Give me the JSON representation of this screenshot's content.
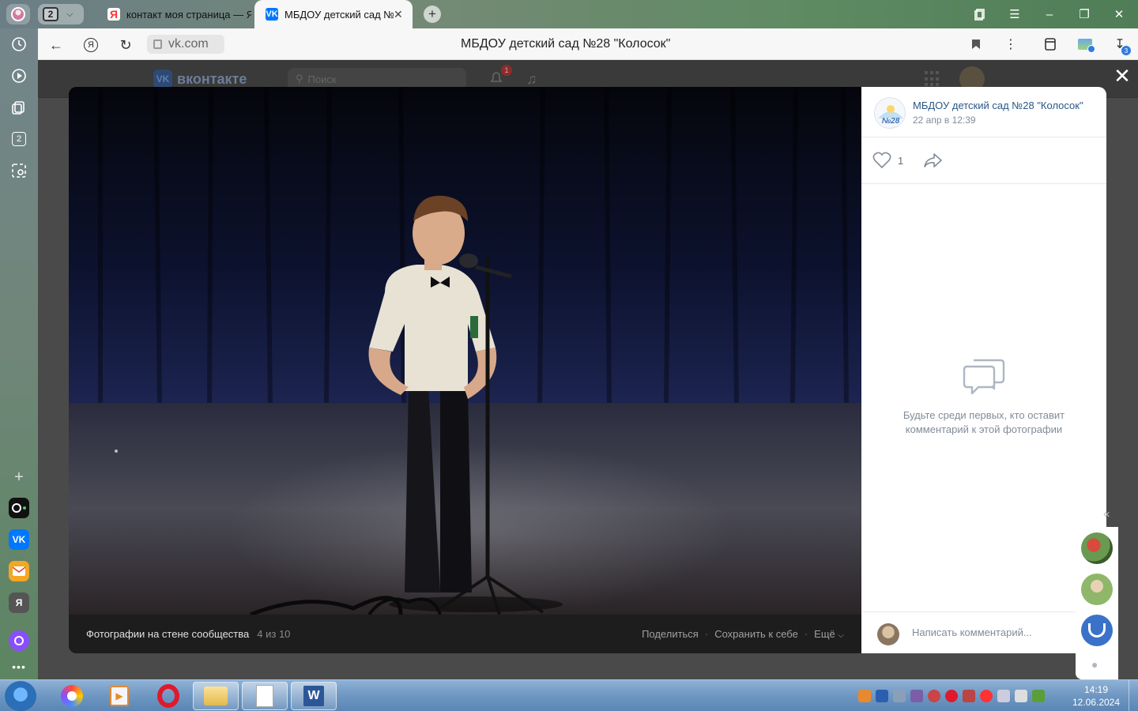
{
  "browser": {
    "tab_count": "2",
    "tabs": [
      {
        "label": "контакт моя страница — Я",
        "favicon": "Я"
      },
      {
        "label": "МБДОУ детский сад №",
        "favicon": "VK"
      }
    ],
    "url_domain": "vk.com",
    "page_title": "МБДОУ детский сад №28 \"Колосок\"",
    "downloads_badge": "3",
    "sidebar_badge": "2"
  },
  "vk": {
    "logo_text": "вконтакте",
    "search_placeholder": "Поиск",
    "notifications_badge": "1"
  },
  "viewer": {
    "album_label": "Фотографии на стене сообщества",
    "counter": "4 из 10",
    "actions": {
      "share": "Поделиться",
      "save": "Сохранить к себе",
      "more": "Ещё"
    },
    "author_name": "МБДОУ детский сад №28 \"Колосок\"",
    "author_avatar_text": "№28",
    "post_date": "22 апр в 12:39",
    "likes": "1",
    "empty_comments_text": "Будьте среди первых, кто оставит комментарий к этой фотографии",
    "comment_placeholder": "Написать комментарий..."
  },
  "taskbar": {
    "time": "14:19",
    "date": "12.06.2024"
  },
  "colors": {
    "vk_blue": "#0077ff",
    "link_blue": "#2a5885",
    "muted_gray": "#818c99"
  }
}
